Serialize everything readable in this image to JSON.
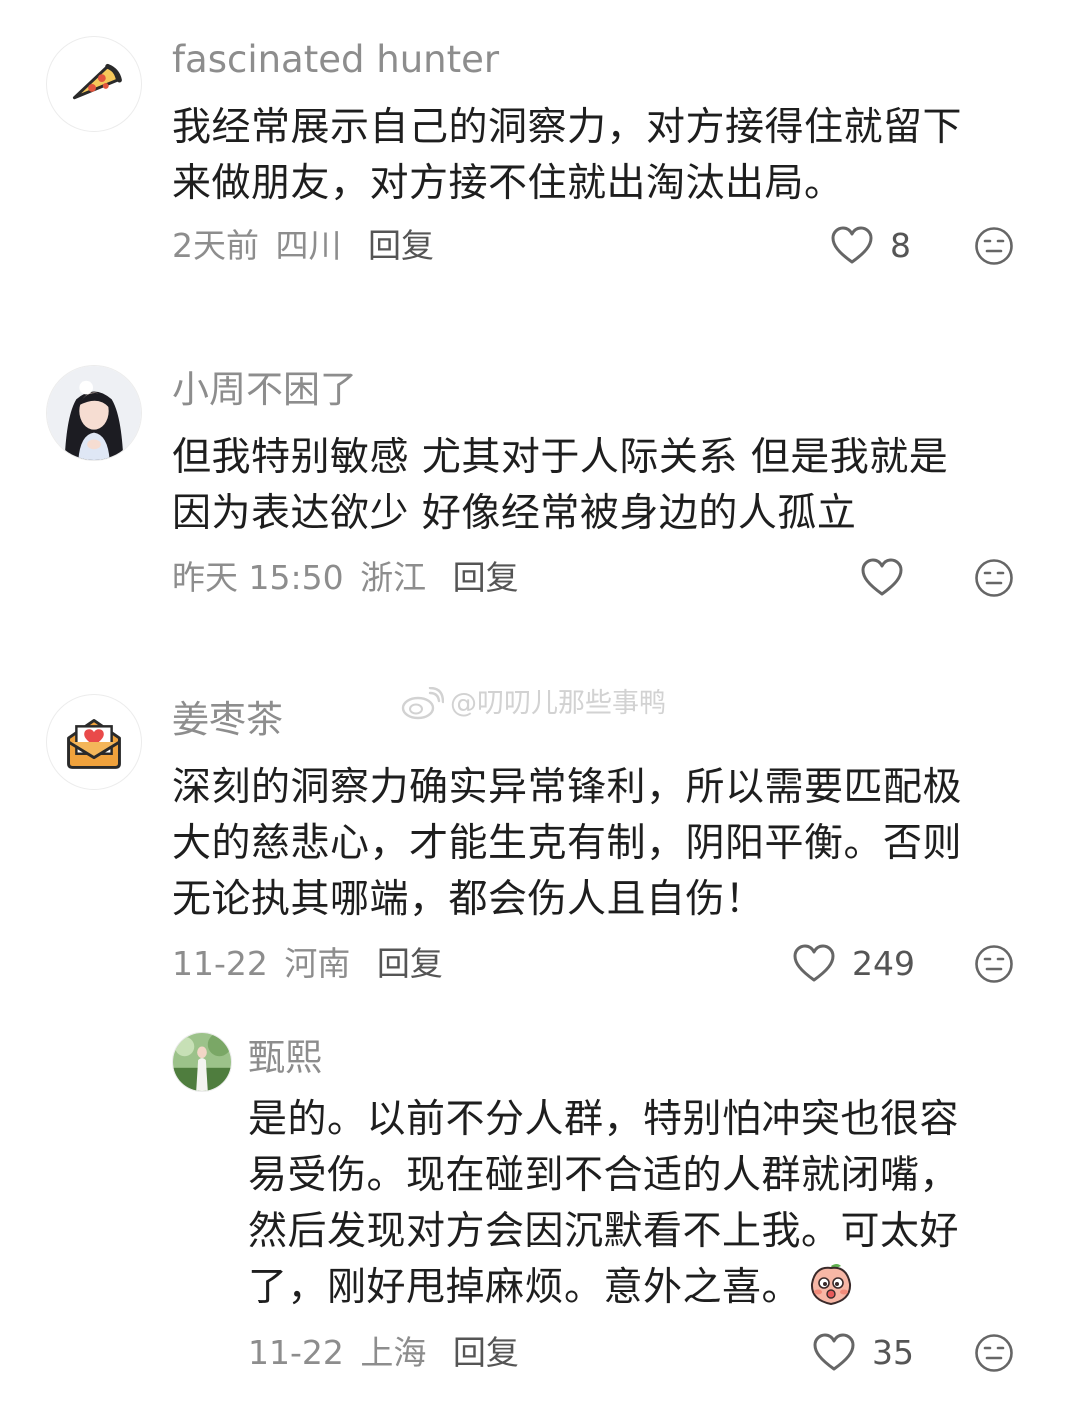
{
  "comments": [
    {
      "username": "fascinated hunter",
      "avatar_icon": "pizza-icon",
      "lines": [
        "我经常展示自己的洞察力，对方接得住就留下",
        "来做朋友，对方接不住就出淘汰出局。"
      ],
      "time": "2天前",
      "location": "四川",
      "reply_label": "回复",
      "likes": "8"
    },
    {
      "username": "小周不困了",
      "avatar_icon": "girl-photo-avatar",
      "lines": [
        "但我特别敏感 尤其对于人际关系  但是我就是",
        "因为表达欲少 好像经常被身边的人孤立"
      ],
      "time": "昨天 15:50",
      "location": "浙江",
      "reply_label": "回复",
      "likes": ""
    },
    {
      "username": "姜枣茶",
      "avatar_icon": "heart-envelope-icon",
      "lines": [
        "深刻的洞察力确实异常锋利，所以需要匹配极",
        "大的慈悲心，才能生克有制，阴阳平衡。否则",
        "无论执其哪端，都会伤人且自伤！"
      ],
      "time": "11-22",
      "location": "河南",
      "reply_label": "回复",
      "likes": "249"
    }
  ],
  "reply": {
    "username": "甄熙",
    "avatar_icon": "photo-avatar",
    "lines": [
      "是的。以前不分人群，特别怕冲突也很容",
      "易受伤。现在碰到不合适的人群就闭嘴，",
      "然后发现对方会因沉默看不上我。可太好",
      "了，刚好甩掉麻烦。意外之喜。"
    ],
    "emoji": "peach-emoji",
    "time": "11-22",
    "location": "上海",
    "reply_label": "回复",
    "likes": "35"
  },
  "watermark": {
    "text": "@叨叨儿那些事鸭",
    "icon": "weibo-icon"
  }
}
